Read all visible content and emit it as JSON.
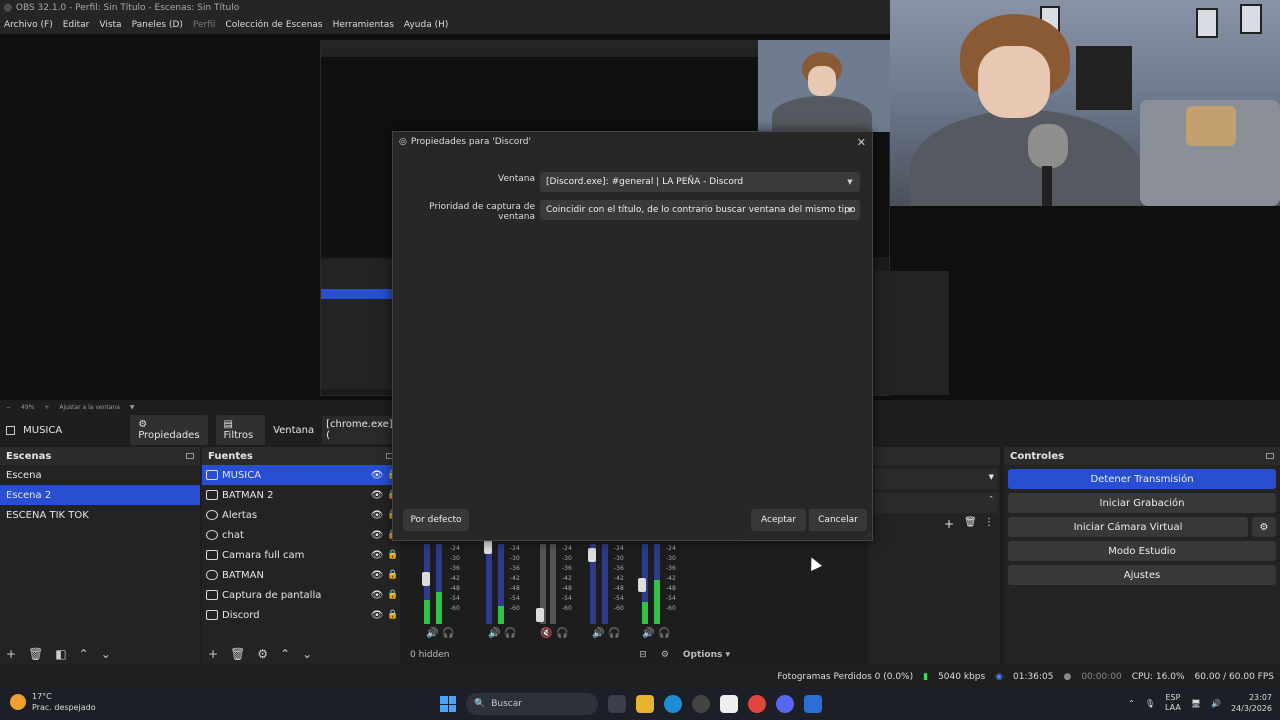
{
  "window": {
    "title": "OBS 32.1.0 - Perfil: Sin Título - Escenas: Sin Título"
  },
  "menu": [
    {
      "label": "Archivo (F)",
      "enabled": true
    },
    {
      "label": "Editar",
      "enabled": true
    },
    {
      "label": "Vista",
      "enabled": true
    },
    {
      "label": "Paneles (D)",
      "enabled": true
    },
    {
      "label": "Perfil",
      "enabled": false
    },
    {
      "label": "Colección de Escenas",
      "enabled": true
    },
    {
      "label": "Herramientas",
      "enabled": true
    },
    {
      "label": "Ayuda (H)",
      "enabled": true
    }
  ],
  "zoom": {
    "value": "49%",
    "fit_label": "Ajustar a la ventana"
  },
  "source_toolbar": {
    "source_name": "MUSICA",
    "properties_label": "Propiedades",
    "filters_label": "Filtros",
    "window_label": "Ventana",
    "window_value": "[chrome.exe]: ("
  },
  "scenes": {
    "title": "Escenas",
    "items": [
      "Escena",
      "Escena 2",
      "ESCENA TIK TOK"
    ],
    "selected_index": 1
  },
  "sources": {
    "title": "Fuentes",
    "items": [
      {
        "label": "MUSICA",
        "icon": "window-capture-icon",
        "selected": true
      },
      {
        "label": "BATMAN 2",
        "icon": "window-capture-icon",
        "selected": false
      },
      {
        "label": "Alertas",
        "icon": "browser-source-icon",
        "selected": false
      },
      {
        "label": "chat",
        "icon": "browser-source-icon",
        "selected": false
      },
      {
        "label": "Camara full cam",
        "icon": "camera-icon",
        "selected": false
      },
      {
        "label": "BATMAN",
        "icon": "gamepad-icon",
        "selected": false
      },
      {
        "label": "Captura de pantalla",
        "icon": "display-capture-icon",
        "selected": false
      },
      {
        "label": "Discord",
        "icon": "window-capture-icon",
        "selected": false
      }
    ]
  },
  "mixer": {
    "hidden_label": "0 hidden",
    "options_label": "Options",
    "scale": [
      "-24",
      "-30",
      "-36",
      "-42",
      "-48",
      "-54",
      "-60"
    ]
  },
  "controls": {
    "title": "Controles",
    "buttons": [
      "Detener Transmisión",
      "Iniciar Grabación",
      "Iniciar Cámara Virtual",
      "Modo Estudio",
      "Ajustes"
    ]
  },
  "status": {
    "dropped": "Fotogramas Perdidos 0 (0.0%)",
    "bitrate": "5040 kbps",
    "stream_time": "01:36:05",
    "rec_time": "00:00:00",
    "cpu": "CPU: 16.0%",
    "fps": "60.00 / 60.00 FPS"
  },
  "dialog": {
    "title": "Propiedades para 'Discord'",
    "window_label": "Ventana",
    "window_value": "[Discord.exe]: #general | LA PEÑA - Discord",
    "priority_label": "Prioridad de captura de ventana",
    "priority_value": "Coincidir con el título, de lo contrario buscar ventana del mismo tipo",
    "default_button": "Por defecto",
    "accept_button": "Aceptar",
    "cancel_button": "Cancelar"
  },
  "taskbar": {
    "weather_temp": "17°C",
    "weather_desc": "Prac. despejado",
    "search_placeholder": "Buscar",
    "lang_top": "ESP",
    "lang_bottom": "LAA",
    "time": "23:07",
    "date": "24/3/2026"
  },
  "colors": {
    "accent": "#284fd1",
    "meter_green": "#33c24a",
    "meter_blue": "#2d3b8a"
  }
}
